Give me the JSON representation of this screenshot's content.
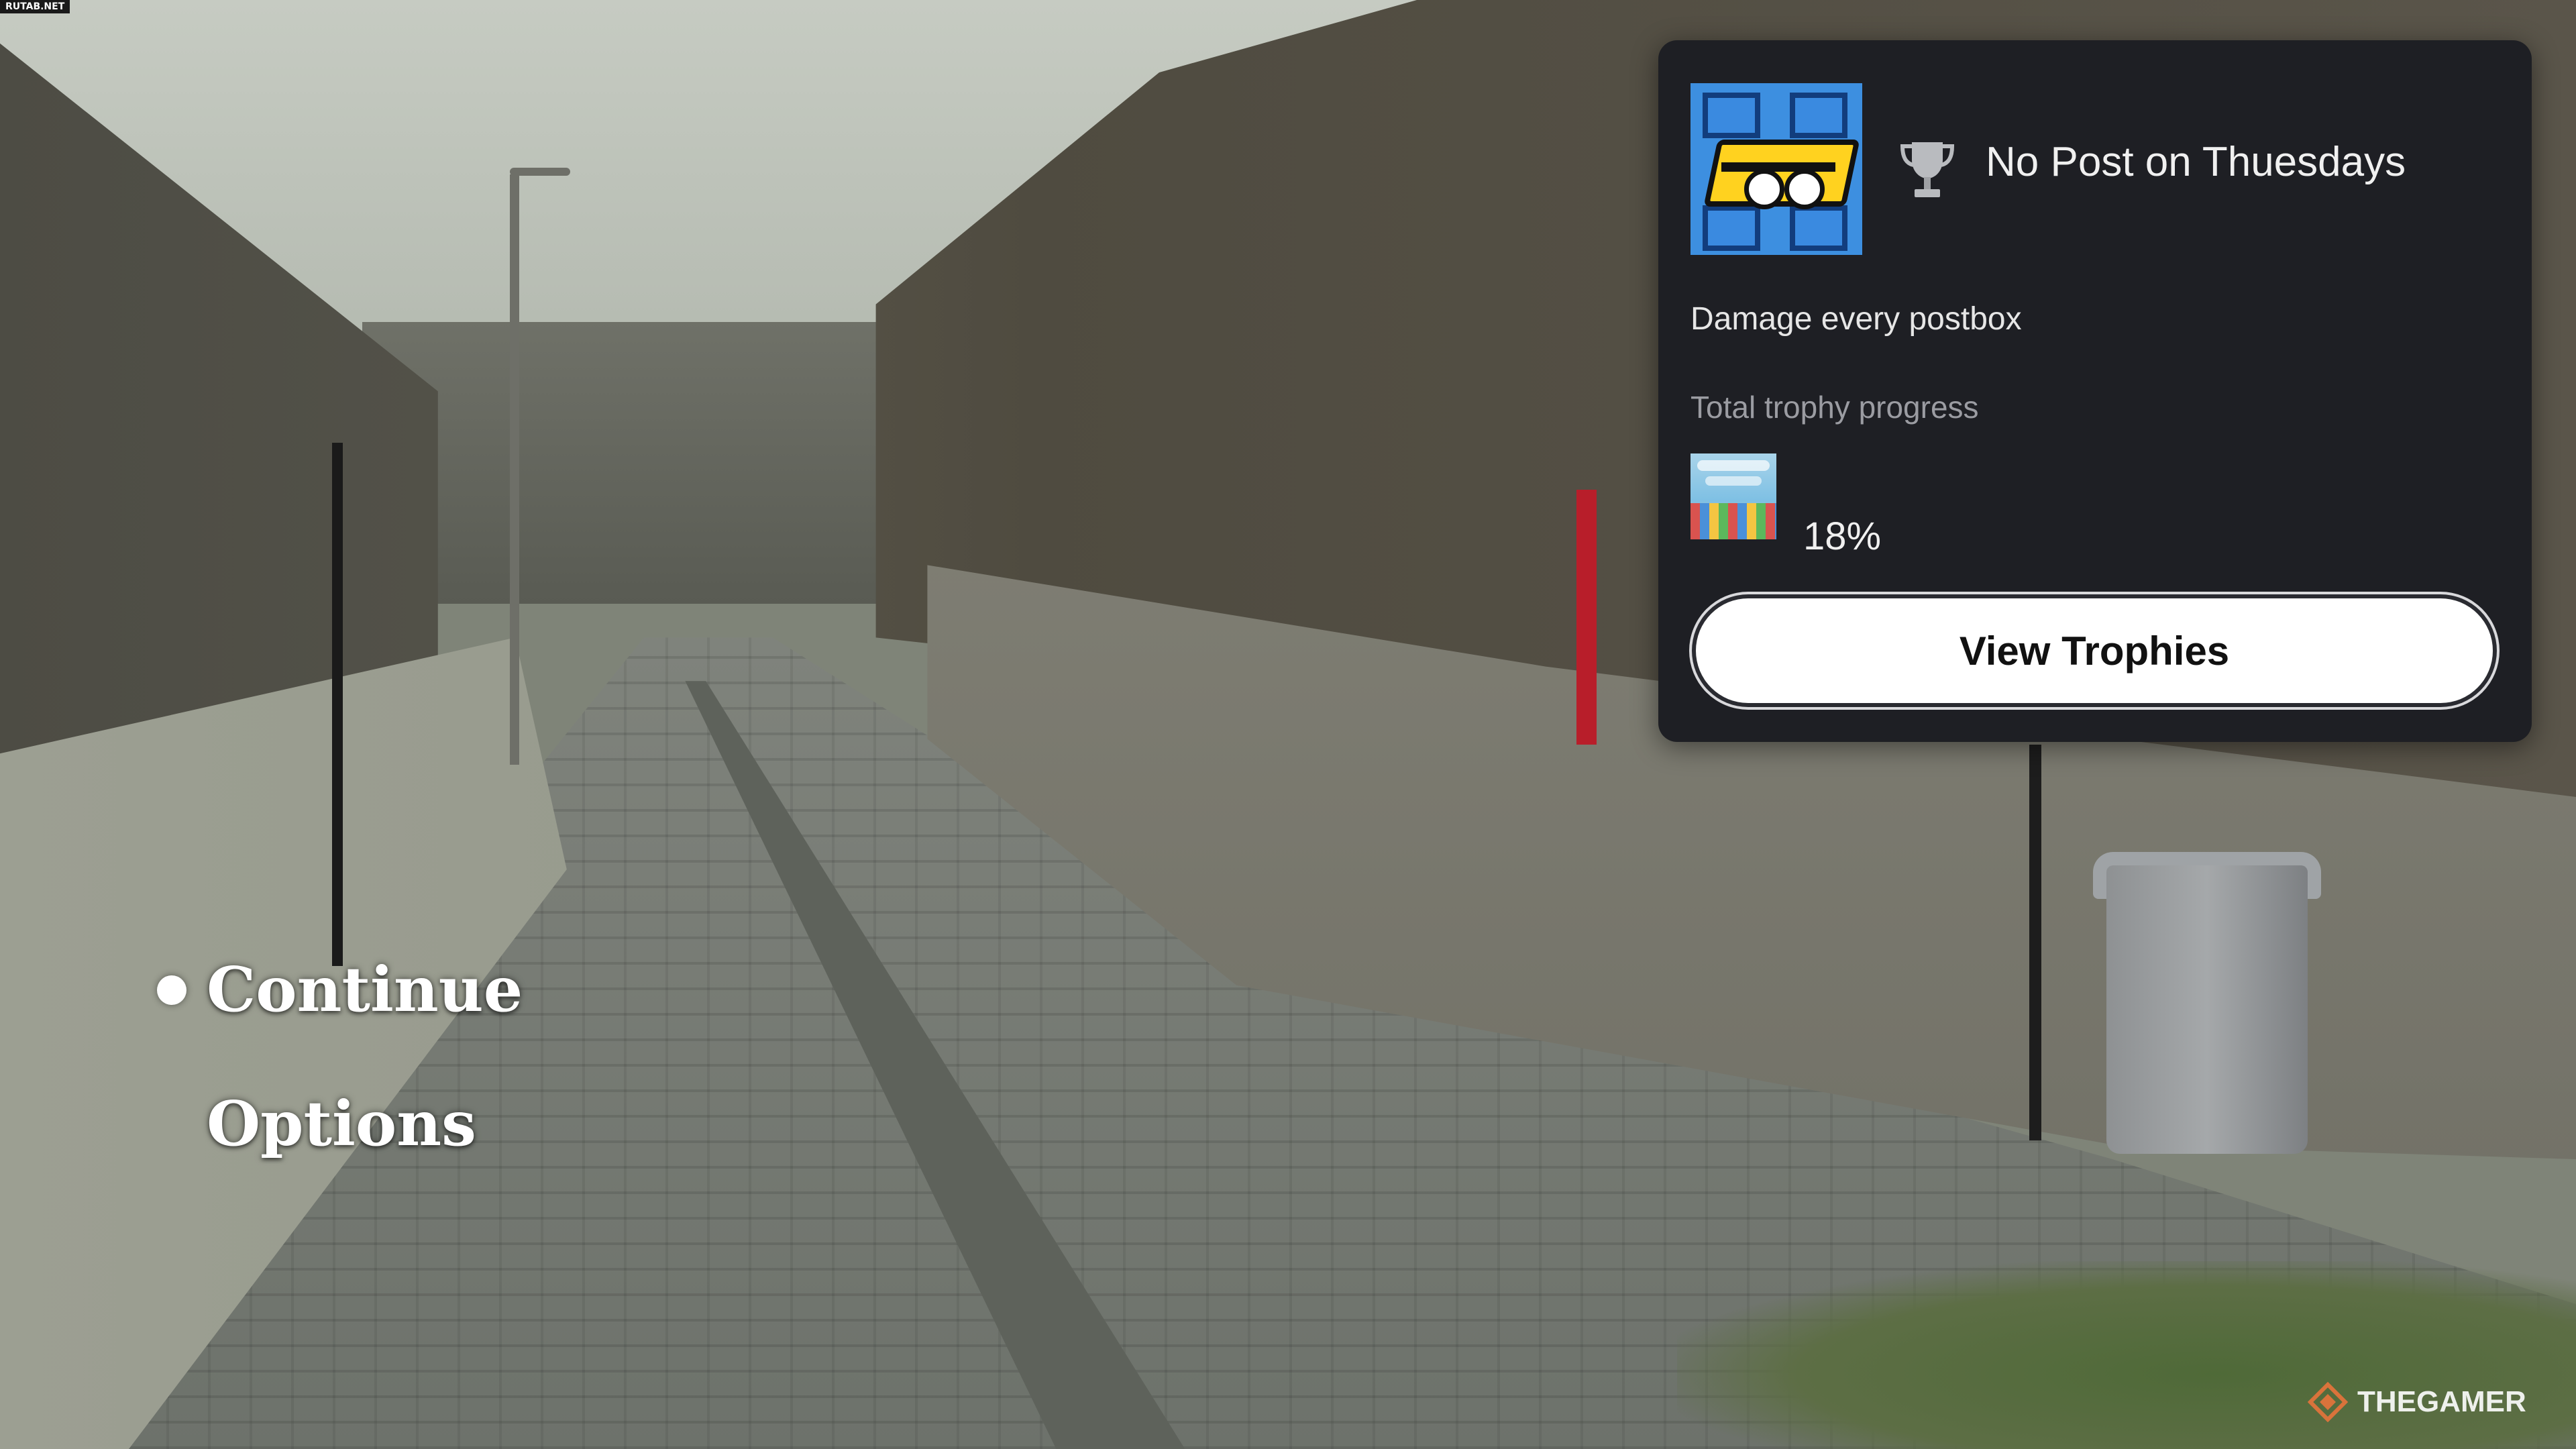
{
  "watermark_top": "RUTAB.NET",
  "menu": {
    "items": [
      {
        "label": "Continue",
        "selected": true
      },
      {
        "label": "Options",
        "selected": false
      }
    ]
  },
  "trophy_popup": {
    "trophy_icon": "trophy-cup-icon",
    "title": "No Post on Thuesdays",
    "description": "Damage every postbox",
    "progress_label": "Total trophy progress",
    "progress_percent": "18%",
    "progress_fraction": 0.18,
    "view_button_label": "View Trophies"
  },
  "watermark_bottom": "THEGAMER",
  "colors": {
    "popup_bg": "#1e1f24",
    "trophy_art_blue": "#3d8fe0",
    "slot_yellow": "#ffd21f",
    "button_bg": "#ffffff"
  }
}
